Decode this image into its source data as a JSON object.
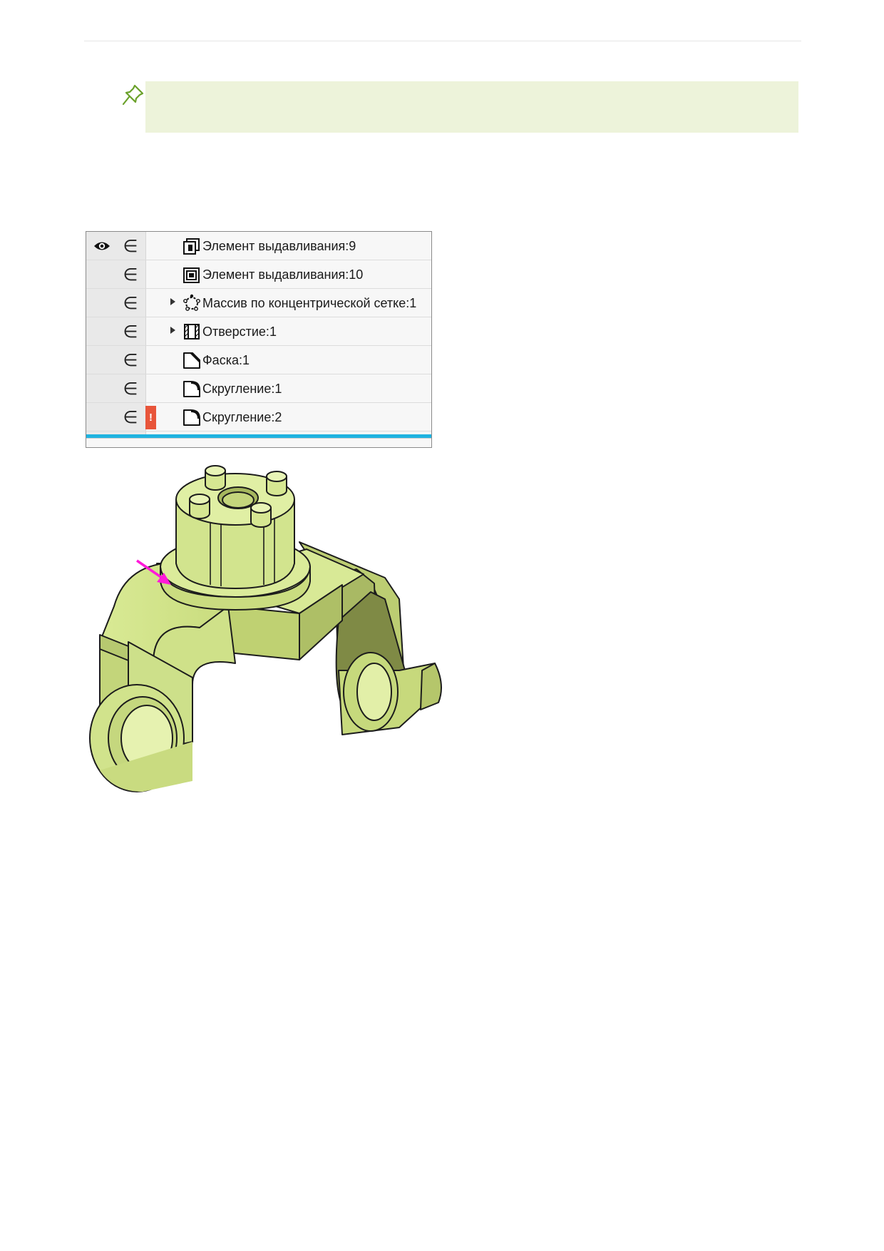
{
  "note": {
    "icon": "pushpin-icon",
    "background": "#edf3da",
    "text": ""
  },
  "tree": {
    "colors": {
      "end_marker": "#1fb3e0",
      "warning": "#e8553a"
    },
    "rows": [
      {
        "label": "Элемент выдавливания:9",
        "icon": "extrusion-icon",
        "visible_eye": true,
        "expandable": false,
        "warning": false
      },
      {
        "label": "Элемент выдавливания:10",
        "icon": "extrusion-icon",
        "visible_eye": false,
        "expandable": false,
        "warning": false
      },
      {
        "label": "Массив по концентрической сетке:1",
        "icon": "circular-pattern-icon",
        "visible_eye": false,
        "expandable": true,
        "warning": false
      },
      {
        "label": "Отверстие:1",
        "icon": "hole-icon",
        "visible_eye": false,
        "expandable": true,
        "warning": false
      },
      {
        "label": "Фаска:1",
        "icon": "chamfer-icon",
        "visible_eye": false,
        "expandable": false,
        "warning": false
      },
      {
        "label": "Скругление:1",
        "icon": "fillet-icon",
        "visible_eye": false,
        "expandable": false,
        "warning": false
      },
      {
        "label": "Скругление:2",
        "icon": "fillet-icon",
        "visible_eye": false,
        "expandable": false,
        "warning": true
      }
    ],
    "membership_glyph": "∈",
    "warning_glyph": "!"
  },
  "model": {
    "colors": {
      "part": "#d4e68c",
      "part_shadow": "#9aa85c",
      "arrow": "#ff1ad9",
      "edge": "#1c1c1c"
    }
  }
}
